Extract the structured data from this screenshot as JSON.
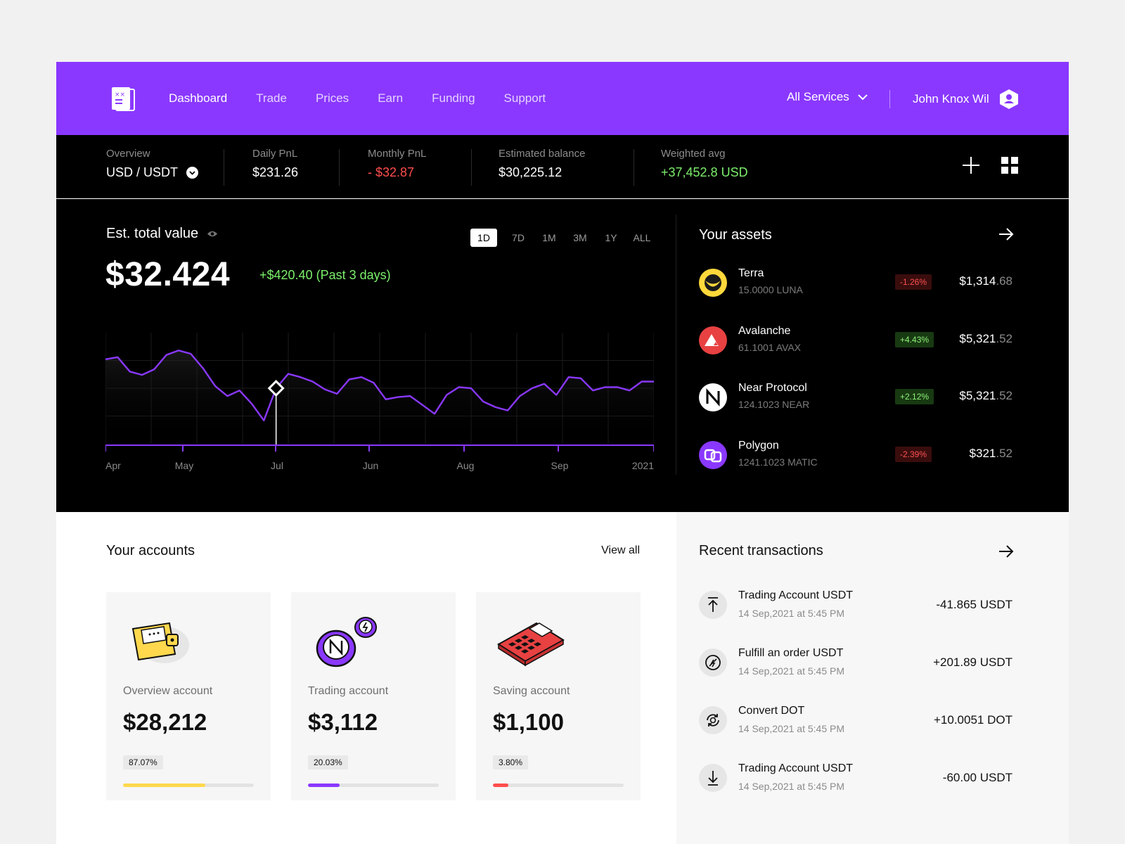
{
  "nav": {
    "items": [
      {
        "label": "Dashboard",
        "active": true
      },
      {
        "label": "Trade"
      },
      {
        "label": "Prices"
      },
      {
        "label": "Earn"
      },
      {
        "label": "Funding"
      },
      {
        "label": "Support"
      }
    ],
    "services_label": "All Services",
    "user_name": "John Knox Wil",
    "accent": "#8a38ff"
  },
  "stats": {
    "overview": {
      "label": "Overview",
      "value": "USD / USDT"
    },
    "daily": {
      "label": "Daily PnL",
      "value": "$231.26"
    },
    "monthly": {
      "label": "Monthly PnL",
      "value": "- $32.87"
    },
    "balance": {
      "label": "Estimated balance",
      "value": "$30,225.12"
    },
    "weighted": {
      "label": "Weighted avg",
      "value": "+37,452.8 USD"
    }
  },
  "total": {
    "title": "Est. total value",
    "value": "$32.424",
    "change": "+$420.40 (Past 3 days)",
    "ranges": [
      "1D",
      "7D",
      "1M",
      "3M",
      "1Y",
      "ALL"
    ],
    "active_range": "1D"
  },
  "chart_data": {
    "type": "line",
    "x": [
      "Apr",
      "May",
      "Jul",
      "Jun",
      "Aug",
      "Sep",
      "2021"
    ],
    "values": [
      76,
      78,
      65,
      62,
      67,
      80,
      84,
      81,
      68,
      52,
      43,
      48,
      36,
      21,
      50,
      63,
      60,
      56,
      49,
      45,
      58,
      60,
      55,
      40,
      42,
      43,
      35,
      27,
      44,
      51,
      50,
      38,
      33,
      30,
      43,
      50,
      54,
      44,
      60,
      59,
      48,
      51,
      51,
      48,
      56,
      56
    ],
    "highlight_index": 14,
    "ylim": [
      0,
      100
    ],
    "line_color": "#8a38ff"
  },
  "assets": {
    "title": "Your assets",
    "items": [
      {
        "name": "Terra",
        "sub": "15.0000 LUNA",
        "change": "-1.26%",
        "dir": "neg",
        "amount": "$1,314",
        "dec": ".68",
        "icon": "terra-icon"
      },
      {
        "name": "Avalanche",
        "sub": "61.1001 AVAX",
        "change": "+4.43%",
        "dir": "pos",
        "amount": "$5,321",
        "dec": ".52",
        "icon": "avalanche-icon"
      },
      {
        "name": "Near Protocol",
        "sub": "124.1023 NEAR",
        "change": "+2.12%",
        "dir": "pos",
        "amount": "$5,321",
        "dec": ".52",
        "icon": "near-icon"
      },
      {
        "name": "Polygon",
        "sub": "1241.1023 MATIC",
        "change": "-2.39%",
        "dir": "neg",
        "amount": "$321",
        "dec": ".52",
        "icon": "polygon-icon"
      }
    ]
  },
  "accounts": {
    "title": "Your accounts",
    "view_all": "View all",
    "items": [
      {
        "label": "Overview account",
        "value": "$28,212",
        "pct": "87.07%",
        "progress": 0.63,
        "color": "#ffd84d",
        "icon": "wallet-illustration"
      },
      {
        "label": "Trading account",
        "value": "$3,112",
        "pct": "20.03%",
        "progress": 0.24,
        "color": "#8a38ff",
        "icon": "coins-illustration"
      },
      {
        "label": "Saving account",
        "value": "$1,100",
        "pct": "3.80%",
        "progress": 0.12,
        "color": "#ff4d4d",
        "icon": "calculator-illustration"
      }
    ]
  },
  "transactions": {
    "title": "Recent transactions",
    "items": [
      {
        "name": "Trading Account USDT",
        "date": "14 Sep,2021 at 5:45 PM",
        "amount": "-41.865 USDT",
        "icon": "upload-icon"
      },
      {
        "name": "Fulfill an order USDT",
        "date": "14 Sep,2021 at 5:45 PM",
        "amount": "+201.89 USDT",
        "icon": "order-icon"
      },
      {
        "name": "Convert DOT",
        "date": "14 Sep,2021 at 5:45 PM",
        "amount": "+10.0051 DOT",
        "icon": "convert-icon"
      },
      {
        "name": "Trading Account USDT",
        "date": "14 Sep,2021 at 5:45 PM",
        "amount": "-60.00 USDT",
        "icon": "download-icon"
      }
    ]
  }
}
